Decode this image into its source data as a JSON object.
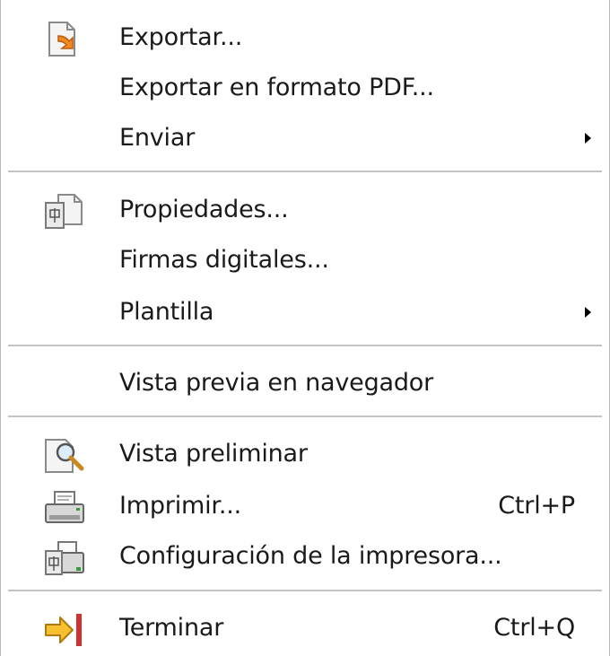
{
  "menu": {
    "items": [
      {
        "label": "Exportar...",
        "shortcut": "",
        "icon": "export-icon",
        "submenu": false
      },
      {
        "label": "Exportar en formato PDF...",
        "shortcut": "",
        "icon": "",
        "submenu": false
      },
      {
        "label": "Enviar",
        "shortcut": "",
        "icon": "",
        "submenu": true
      },
      {
        "label": "Propiedades...",
        "shortcut": "",
        "icon": "properties-icon",
        "submenu": false
      },
      {
        "label": "Firmas digitales...",
        "shortcut": "",
        "icon": "",
        "submenu": false
      },
      {
        "label": "Plantilla",
        "shortcut": "",
        "icon": "",
        "submenu": true
      },
      {
        "label": "Vista previa en navegador",
        "shortcut": "",
        "icon": "",
        "submenu": false
      },
      {
        "label": "Vista preliminar",
        "shortcut": "",
        "icon": "print-preview-icon",
        "submenu": false
      },
      {
        "label": "Imprimir...",
        "shortcut": "Ctrl+P",
        "icon": "printer-icon",
        "submenu": false
      },
      {
        "label": "Configuración de la impresora...",
        "shortcut": "",
        "icon": "printer-settings-icon",
        "submenu": false
      },
      {
        "label": "Terminar",
        "shortcut": "Ctrl+Q",
        "icon": "exit-icon",
        "submenu": false
      }
    ]
  },
  "colors": {
    "separator": "#c4c4c4",
    "text": "#1a1a1a",
    "icon_accent_orange": "#e8a020",
    "icon_accent_red": "#d03030"
  }
}
